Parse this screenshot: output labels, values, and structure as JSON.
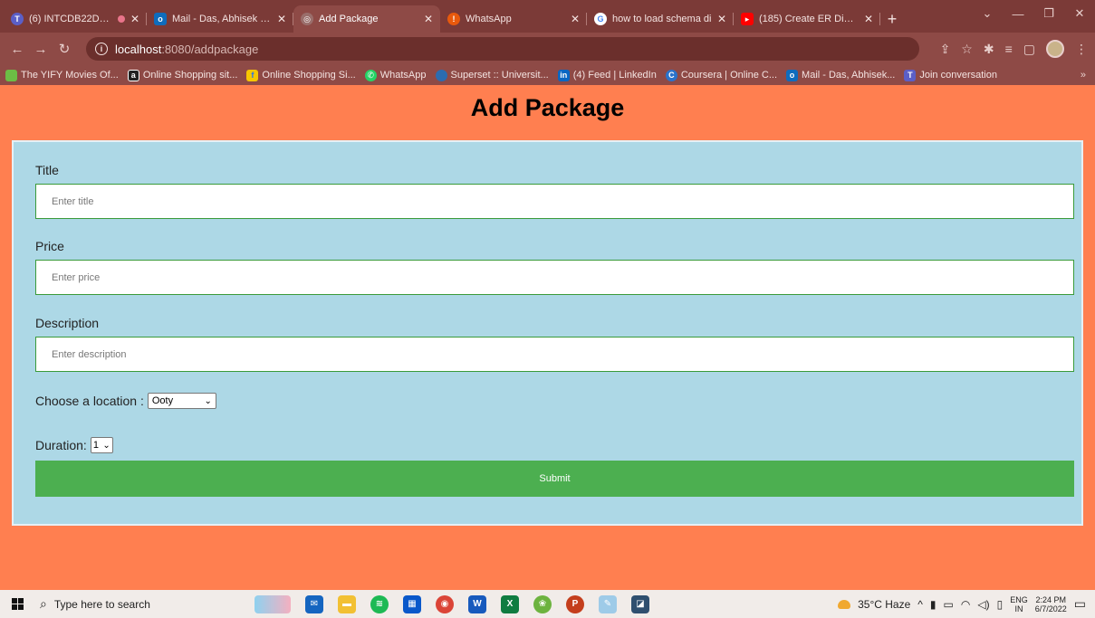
{
  "browser": {
    "tabs": [
      {
        "label": "(6) INTCDB22DX01",
        "favicon": "teams-icon",
        "color": "#5b5fc7"
      },
      {
        "label": "Mail - Das, Abhisek (Co",
        "favicon": "outlook-icon",
        "color": "#0f6cbd"
      },
      {
        "label": "Add Package",
        "favicon": "globe-icon",
        "color": "#9a6e6b",
        "active": true
      },
      {
        "label": "WhatsApp",
        "favicon": "whatsapp-alert-icon",
        "color": "#e8590c"
      },
      {
        "label": "how to load schema di",
        "favicon": "google-icon",
        "color": "#ffffff"
      },
      {
        "label": "(185) Create ER Diagra",
        "favicon": "youtube-icon",
        "color": "#ff0000"
      }
    ],
    "url_host": "localhost",
    "url_rest": ":8080/addpackage",
    "bookmarks": [
      {
        "label": "The YIFY Movies Of...",
        "color": "#6cbd45"
      },
      {
        "label": "Online Shopping sit...",
        "color": "#222222",
        "glyph": "a"
      },
      {
        "label": "Online Shopping Si...",
        "color": "#f7c600"
      },
      {
        "label": "WhatsApp",
        "color": "#25d366"
      },
      {
        "label": "Superset :: Universit...",
        "color": "#2b6cb0"
      },
      {
        "label": "(4) Feed | LinkedIn",
        "color": "#0a66c2",
        "glyph": "in"
      },
      {
        "label": "Coursera | Online C...",
        "color": "#2a73cc",
        "glyph": "C"
      },
      {
        "label": "Mail - Das, Abhisek...",
        "color": "#0f6cbd"
      },
      {
        "label": "Join conversation",
        "color": "#5b5fc7"
      }
    ]
  },
  "page": {
    "title": "Add Package",
    "title_field": {
      "label": "Title",
      "placeholder": "Enter title"
    },
    "price_field": {
      "label": "Price",
      "placeholder": "Enter price"
    },
    "description_field": {
      "label": "Description",
      "placeholder": "Enter description"
    },
    "location": {
      "label": "Choose a location :",
      "value": "Ooty"
    },
    "duration": {
      "label": "Duration:",
      "value": "1"
    },
    "submit_label": "Submit"
  },
  "taskbar": {
    "search_placeholder": "Type here to search",
    "weather": "35°C  Haze",
    "lang_top": "ENG",
    "lang_bottom": "IN",
    "time": "2:24 PM",
    "date": "6/7/2022"
  },
  "colors": {
    "page_bg": "#ff7f50",
    "form_bg": "#add8e6",
    "submit_bg": "#4caf50",
    "input_border": "#3a9a3a"
  }
}
